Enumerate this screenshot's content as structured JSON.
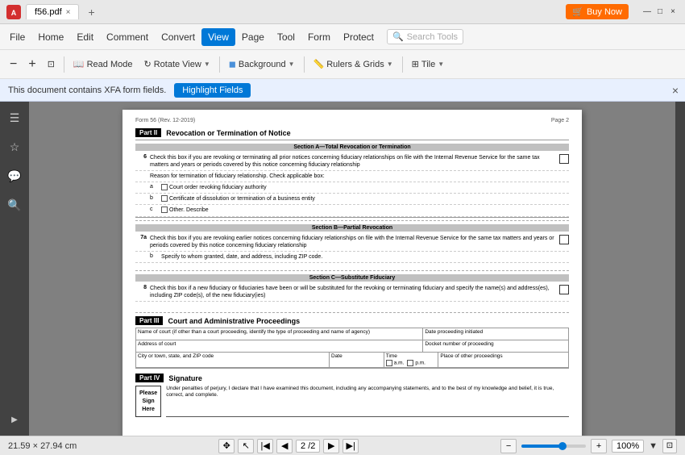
{
  "window": {
    "title": "f56.pdf",
    "app_icon": "A",
    "tab_label": "f56.pdf",
    "close_tab": "×",
    "add_tab": "+"
  },
  "title_bar": {
    "buy_now": "Buy Now",
    "minimize": "—",
    "maximize": "□",
    "close": "×"
  },
  "menu": {
    "items": [
      "File",
      "Home",
      "Edit",
      "Comment",
      "Convert",
      "View",
      "Page",
      "Tool",
      "Form",
      "Protect"
    ],
    "active": "View",
    "search_placeholder": "Search Tools"
  },
  "toolbar": {
    "zoom_out": "−",
    "zoom_in": "+",
    "fit_page": "⊡",
    "read_mode": "Read Mode",
    "rotate_view": "Rotate View",
    "background": "Background",
    "rulers_grid": "Rulers & Grids",
    "tile": "Tile"
  },
  "notification": {
    "text": "This document contains XFA form fields.",
    "highlight_btn": "Highlight Fields",
    "close": "×"
  },
  "left_panel": {
    "icons": [
      "☰",
      "☆",
      "💬",
      "🔍"
    ]
  },
  "pdf": {
    "form_num": "Form 56 (Rev. 12-2019)",
    "page_label": "Page 2",
    "part2_label": "Part II",
    "part2_title": "Revocation or Termination of Notice",
    "section_a": "Section A—Total Revocation or Termination",
    "row6_text": "Check this box if you are revoking or terminating all prior notices concerning fiduciary relationships on file with the Internal Revenue Service for the same tax matters and years or periods covered by this notice concerning fiduciary relationship",
    "row6_subtext": "Reason for termination of fiduciary relationship. Check applicable box:",
    "row_a_text": "Court order revoking fiduciary authority",
    "row_b_text": "Certificate of dissolution or termination of a business entity",
    "row_c_text": "Other. Describe",
    "section_b": "Section B—Partial Revocation",
    "row7a_text": "Check this box if you are revoking earlier notices concerning fiduciary relationships on file with the Internal Revenue Service for the same tax matters and years or periods covered by this notice concerning fiduciary relationship",
    "row7b_text": "Specify to whom granted, date, and address, including ZIP code.",
    "section_c": "Section C—Substitute Fiduciary",
    "row8_text": "Check this box if a new fiduciary or fiduciaries have been or will be substituted for the revoking or terminating fiduciary and specify the name(s) and address(es), including ZIP code(s), of the new fiduciary(ies)",
    "part3_label": "Part III",
    "part3_title": "Court and Administrative Proceedings",
    "col_court": "Name of court (if other than a court proceeding, identify the type of proceeding and name of agency)",
    "col_date": "Date proceeding initiated",
    "col_address": "Address of court",
    "col_docket": "Docket number of proceeding",
    "col_city": "City or town, state, and ZIP code",
    "col_date2": "Date",
    "col_time": "Time",
    "col_am": "a.m.",
    "col_pm": "p.m.",
    "col_place": "Place of other proceedings",
    "part4_label": "Part IV",
    "part4_title": "Signature",
    "sig_text": "Under penalties of perjury, I declare that I have examined this document, including any accompanying statements, and to the best of my knowledge and belief, it is true, correct, and complete.",
    "please_sign": "Please\nSign\nHere"
  },
  "status_bar": {
    "dimensions": "21.59 × 27.94 cm",
    "pan_icon": "✥",
    "cursor_icon": "↖",
    "first_page": "⏮",
    "prev_page": "◀",
    "page_num": "2 /2",
    "next_page": "▶",
    "last_page": "⏭",
    "zoom_minus": "−",
    "zoom_plus": "+",
    "zoom_level": "100%",
    "fit_icon": "⊡"
  }
}
